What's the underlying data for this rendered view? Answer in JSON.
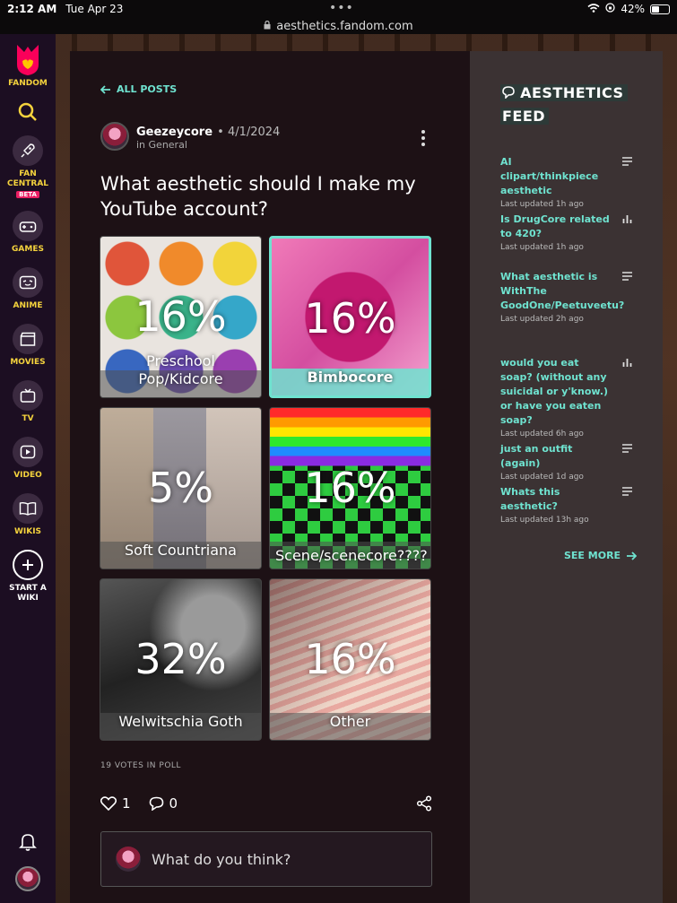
{
  "status": {
    "time": "2:12 AM",
    "date": "Tue Apr 23",
    "battery": "42%",
    "battery_level": 0.42
  },
  "url": "aesthetics.fandom.com",
  "rail": {
    "brand": "FANDOM",
    "items": [
      {
        "label": "FAN CENTRAL",
        "badge": "BETA"
      },
      {
        "label": "GAMES"
      },
      {
        "label": "ANIME"
      },
      {
        "label": "MOVIES"
      },
      {
        "label": "TV"
      },
      {
        "label": "VIDEO"
      },
      {
        "label": "WIKIS"
      },
      {
        "label": "START A WIKI"
      }
    ]
  },
  "post": {
    "back_label": "ALL POSTS",
    "author": "Geezeycore",
    "date": "4/1/2024",
    "category": "in General",
    "title": "What aesthetic should I make my YouTube account?",
    "options": [
      {
        "pct": "16%",
        "label": "Preschool Pop/Kidcore",
        "selected": false
      },
      {
        "pct": "16%",
        "label": "Bimbocore",
        "selected": true
      },
      {
        "pct": "5%",
        "label": "Soft Countriana",
        "selected": false
      },
      {
        "pct": "16%",
        "label": "Scene/scenecore????",
        "selected": false
      },
      {
        "pct": "32%",
        "label": "Welwitschia Goth",
        "selected": false
      },
      {
        "pct": "16%",
        "label": "Other",
        "selected": false
      }
    ],
    "votes": "19 VOTES IN POLL",
    "likes": "1",
    "comments": "0",
    "comment_placeholder": "What do you think?"
  },
  "feed": {
    "title_line1": "AESTHETICS",
    "title_line2": "FEED",
    "items": [
      {
        "title": "AI clipart/thinkpiece aesthetic",
        "updated": "Last updated 1h ago",
        "icon": "text-lines-icon"
      },
      {
        "title": "Is DrugCore related to 420?",
        "updated": "Last updated 1h ago",
        "icon": "poll-bars-icon"
      },
      {
        "title": "What aesthetic is WithThe GoodOne/Peetuveetu?",
        "updated": "Last updated 2h ago",
        "icon": "text-lines-icon"
      },
      {
        "title": "would you eat soap? (without any suicidal or y'know.) or have you eaten soap?",
        "updated": "Last updated 6h ago",
        "icon": "poll-bars-icon"
      },
      {
        "title": "just an outfit (again)",
        "updated": "Last updated 1d ago",
        "icon": "text-lines-icon"
      },
      {
        "title": "Whats this aesthetic?",
        "updated": "Last updated 13h ago",
        "icon": "text-lines-icon"
      }
    ],
    "see_more": "SEE MORE"
  },
  "colors": {
    "accent": "#6fe3d0",
    "rail_label": "#f5d33d",
    "rail_bg": "#1c0e22",
    "card_bg": "#1d1115",
    "feed_bg": "#3b3233"
  }
}
